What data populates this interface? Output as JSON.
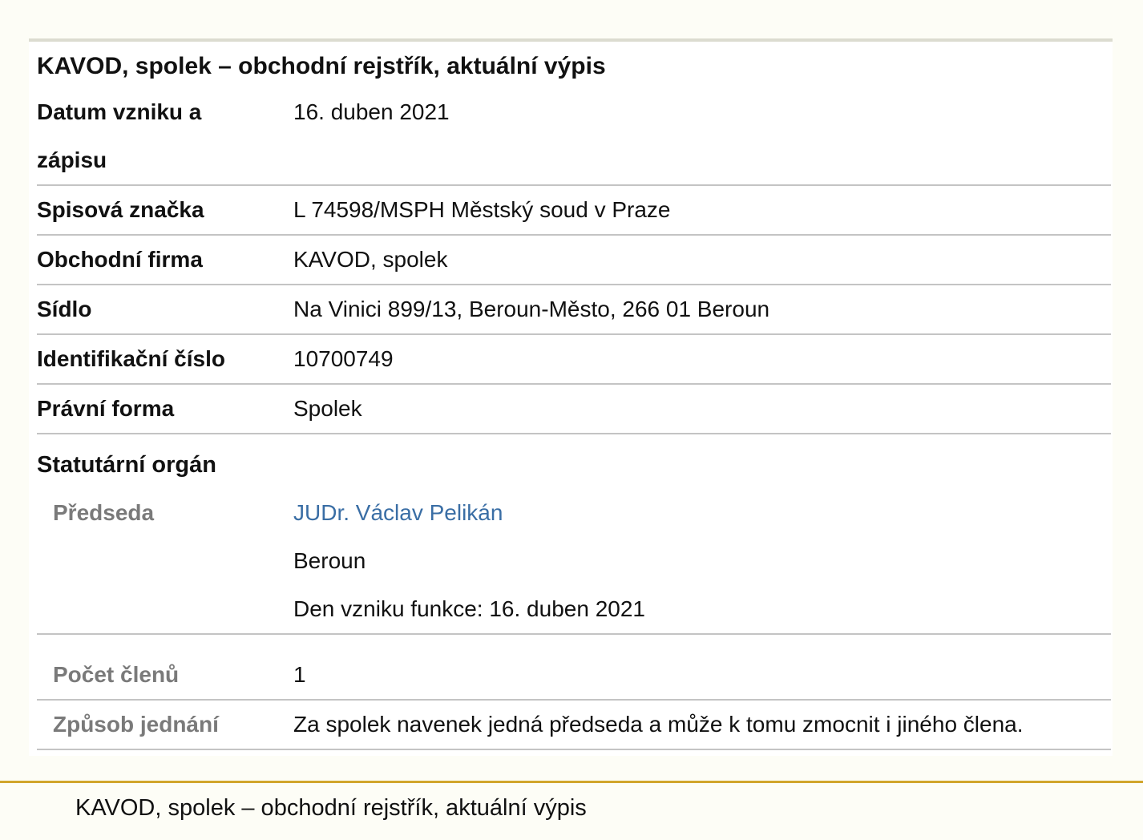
{
  "title": "KAVOD, spolek – obchodní rejstřík, aktuální výpis",
  "rows": {
    "datum": {
      "label_line1": "Datum vzniku a",
      "label_line2": "zápisu",
      "value": "16. duben 2021"
    },
    "spisova": {
      "label": "Spisová značka",
      "value": "L 74598/MSPH Městský soud v Praze"
    },
    "firma": {
      "label": "Obchodní firma",
      "value": "KAVOD, spolek"
    },
    "sidlo": {
      "label": "Sídlo",
      "value": "Na Vinici 899/13, Beroun-Město, 266 01 Beroun"
    },
    "ico": {
      "label": "Identifikační číslo",
      "value": "10700749"
    },
    "pravni": {
      "label": "Právní forma",
      "value": "Spolek"
    }
  },
  "statutarni": {
    "heading": "Statutární orgán",
    "predseda": {
      "label": "Předseda",
      "name": "JUDr. Václav Pelikán",
      "city": "Beroun",
      "since": "Den vzniku funkce: 16. duben 2021"
    },
    "pocet": {
      "label": "Počet členů",
      "value": "1"
    },
    "zpusob": {
      "label": "Způsob jednání",
      "value": "Za spolek navenek jedná předseda a může k tomu zmocnit i jiného člena."
    }
  },
  "footer": {
    "text": "KAVOD, spolek – obchodní rejstřík, aktuální výpis"
  }
}
